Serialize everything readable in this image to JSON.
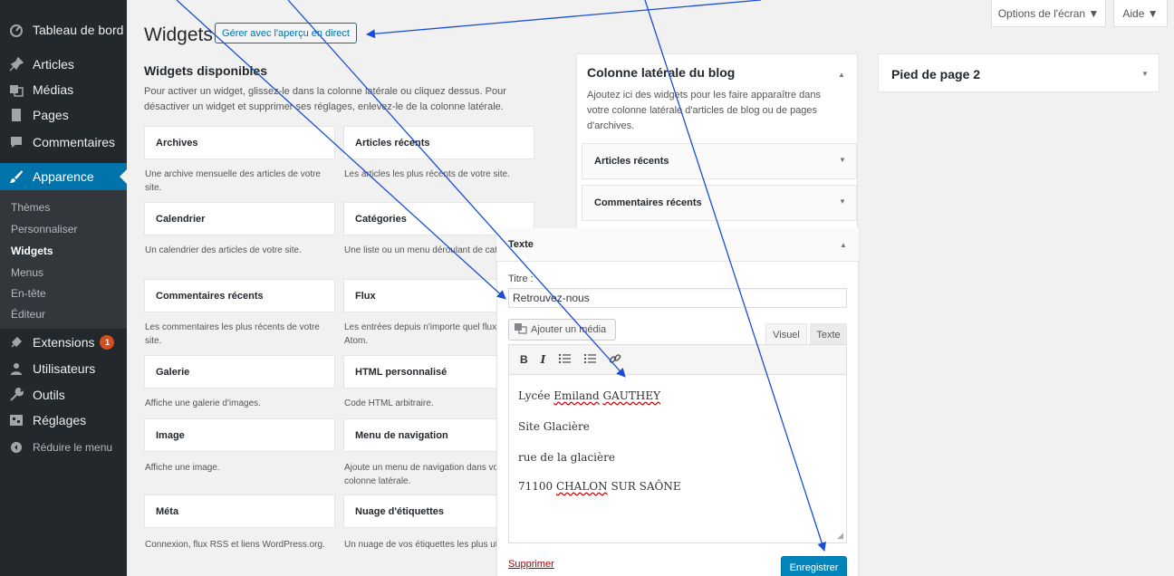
{
  "sidebar": {
    "items": [
      {
        "label": "Tableau de bord",
        "icon": "dashboard-icon"
      },
      {
        "label": "Articles",
        "icon": "pin-icon"
      },
      {
        "label": "Médias",
        "icon": "media-icon"
      },
      {
        "label": "Pages",
        "icon": "pages-icon"
      },
      {
        "label": "Commentaires",
        "icon": "comments-icon"
      },
      {
        "label": "Apparence",
        "icon": "brush-icon"
      },
      {
        "label": "Extensions",
        "icon": "plugin-icon",
        "badge": "1"
      },
      {
        "label": "Utilisateurs",
        "icon": "users-icon"
      },
      {
        "label": "Outils",
        "icon": "tools-icon"
      },
      {
        "label": "Réglages",
        "icon": "settings-icon"
      },
      {
        "label": "Réduire le menu",
        "icon": "collapse-icon"
      }
    ],
    "submenu": [
      "Thèmes",
      "Personnaliser",
      "Widgets",
      "Menus",
      "En-tête",
      "Éditeur"
    ]
  },
  "topbar": {
    "screen_options": "Options de l'écran ▼",
    "help": "Aide ▼"
  },
  "header": {
    "title": "Widgets",
    "live_button": "Gérer avec l'aperçu en direct"
  },
  "available": {
    "title": "Widgets disponibles",
    "description": "Pour activer un widget, glissez-le dans la colonne latérale ou cliquez dessus. Pour désactiver un widget et supprimer ses réglages, enlevez-le de la colonne latérale.",
    "widgets": [
      {
        "name": "Archives",
        "desc": "Une archive mensuelle des articles de votre site."
      },
      {
        "name": "Articles récents",
        "desc": "Les articles les plus récents de votre site."
      },
      {
        "name": "Calendrier",
        "desc": "Un calendrier des articles de votre site."
      },
      {
        "name": "Catégories",
        "desc": "Une liste ou un menu déroulant de catégories."
      },
      {
        "name": "Commentaires récents",
        "desc": "Les commentaires les plus récents de votre site."
      },
      {
        "name": "Flux",
        "desc": "Les entrées depuis n'importe quel flux RSS ou Atom."
      },
      {
        "name": "Galerie",
        "desc": "Affiche une galerie d'images."
      },
      {
        "name": "HTML personnalisé",
        "desc": "Code HTML arbitraire."
      },
      {
        "name": "Image",
        "desc": "Affiche une image."
      },
      {
        "name": "Menu de navigation",
        "desc": "Ajoute un menu de navigation dans votre colonne latérale."
      },
      {
        "name": "Méta",
        "desc": "Connexion, flux RSS et liens WordPress.org."
      },
      {
        "name": "Nuage d'étiquettes",
        "desc": "Un nuage de vos étiquettes les plus utilisées."
      }
    ]
  },
  "blog_sidebar": {
    "title": "Colonne latérale du blog",
    "description": "Ajoutez ici des widgets pour les faire apparaître dans votre colonne latérale d'articles de blog ou de pages d'archives.",
    "widgets": [
      "Articles récents",
      "Commentaires récents"
    ]
  },
  "footer2": {
    "title": "Pied de page 2"
  },
  "text_widget": {
    "header": "Texte",
    "title_label": "Titre :",
    "title_value": "Retrouvez-nous",
    "add_media": "Ajouter un média",
    "tab_visual": "Visuel",
    "tab_text": "Texte",
    "toolbar": {
      "bold": "B",
      "italic": "I"
    },
    "content": {
      "line1_a": "Lycée ",
      "line1_b": "Emiland",
      "line1_c": " ",
      "line1_d": "GAUTHEY",
      "line2": "Site Glacière",
      "line3": "rue de la glacière",
      "line4_a": "71100 ",
      "line4_b": "CHALON",
      "line4_c": " SUR SAÔNE"
    },
    "delete": "Supprimer",
    "save": "Enregistrer"
  },
  "colors": {
    "sidebar_bg": "#23282d",
    "active_bg": "#0073aa",
    "save_bg": "#0085ba",
    "arrow": "#1a4ed8"
  }
}
